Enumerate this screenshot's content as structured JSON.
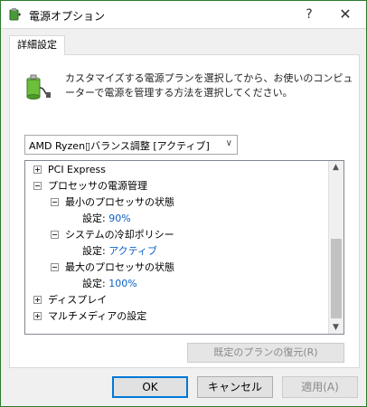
{
  "window": {
    "title": "電源オプション",
    "help_glyph": "?",
    "close_glyph": "✕",
    "icon": "power-options-icon"
  },
  "tab": {
    "label": "詳細設定"
  },
  "header": {
    "icon": "battery-plug-icon",
    "description": "カスタマイズする電源プランを選択してから、お使いのコンピューターで電源を管理する方法を選択してください。"
  },
  "plan_dropdown": {
    "value": "AMD Ryzen",
    "value_glyph": "▯",
    "value_suffix": "バランス調整 [アクティブ]"
  },
  "tree": {
    "items": [
      {
        "label": "PCI Express",
        "toggle": "plus"
      },
      {
        "label": "プロセッサの電源管理",
        "toggle": "minus"
      },
      {
        "label": "最小のプロセッサの状態",
        "toggle": "minus"
      },
      {
        "label": "設定: ",
        "value": "90%"
      },
      {
        "label": "システムの冷却ポリシー",
        "toggle": "minus"
      },
      {
        "label": "設定: ",
        "value": "アクティブ"
      },
      {
        "label": "最大のプロセッサの状態",
        "toggle": "minus"
      },
      {
        "label": "設定: ",
        "value": "100%"
      },
      {
        "label": "ディスプレイ",
        "toggle": "plus"
      },
      {
        "label": "マルチメディアの設定",
        "toggle": "plus"
      }
    ]
  },
  "restore_button": {
    "label": "既定のプランの復元(R)"
  },
  "buttons": {
    "ok": "OK",
    "cancel": "キャンセル",
    "apply": "適用(A)"
  },
  "colors": {
    "setting_value": "#0b61c4",
    "focus_border": "#0078d7"
  }
}
